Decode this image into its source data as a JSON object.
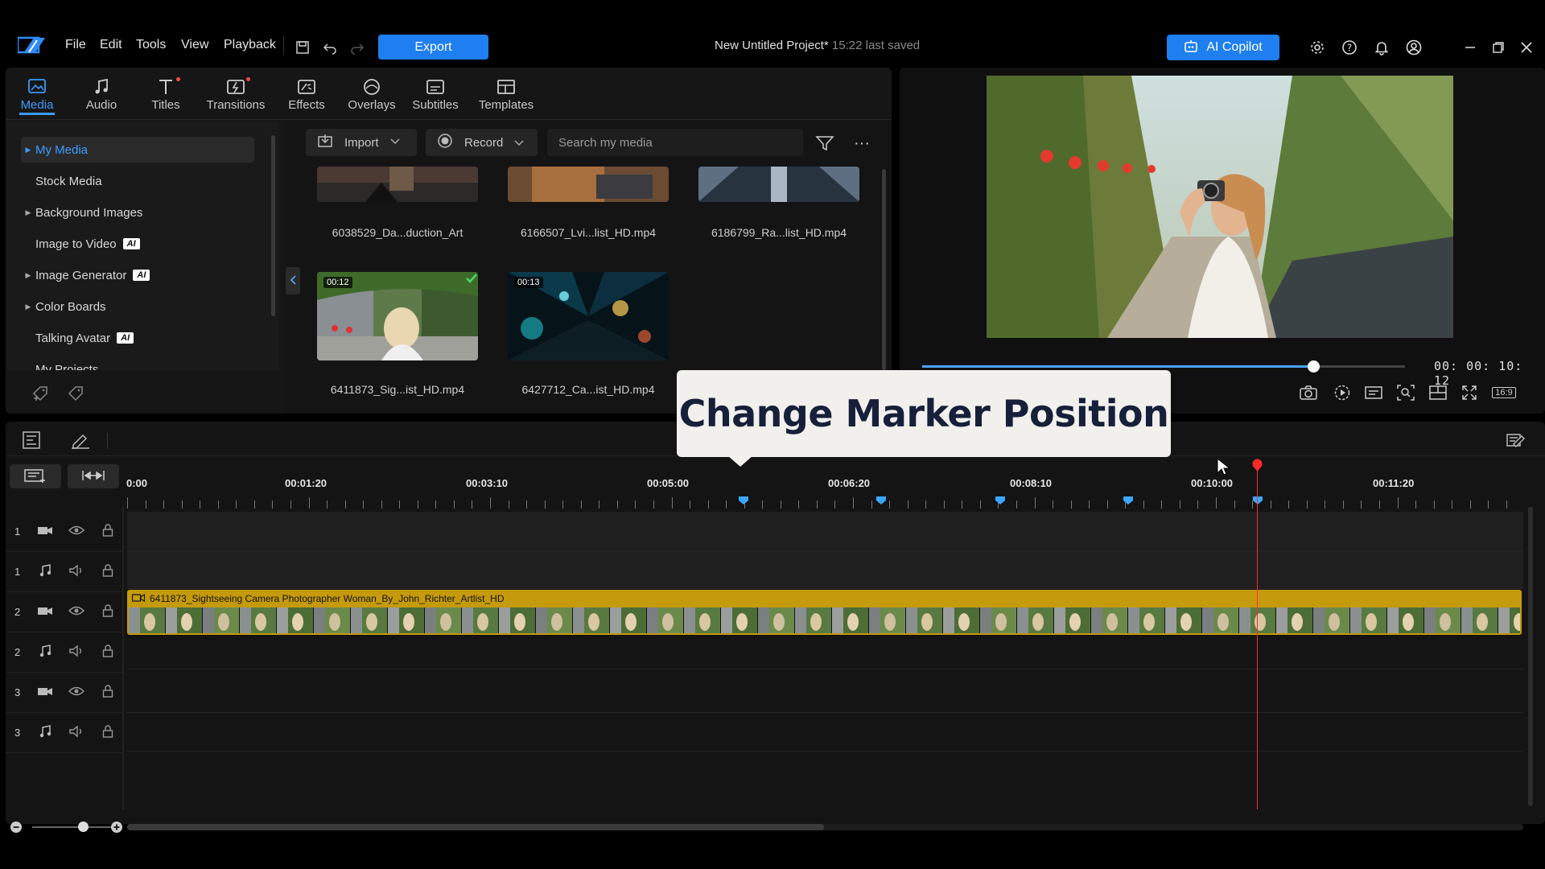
{
  "menu": {
    "file": "File",
    "edit": "Edit",
    "tools": "Tools",
    "view": "View",
    "playback": "Playback"
  },
  "toolbar": {
    "export_label": "Export"
  },
  "project": {
    "title": "New Untitled Project*",
    "saved": "15:22 last saved"
  },
  "ai_copilot": {
    "label": "AI Copilot"
  },
  "tabs": [
    {
      "label": "Media",
      "icon": "media-icon"
    },
    {
      "label": "Audio",
      "icon": "music-note-icon"
    },
    {
      "label": "Titles",
      "icon": "titles-icon"
    },
    {
      "label": "Transitions",
      "icon": "transitions-icon"
    },
    {
      "label": "Effects",
      "icon": "effects-icon"
    },
    {
      "label": "Overlays",
      "icon": "overlays-icon"
    },
    {
      "label": "Subtitles",
      "icon": "subtitles-icon"
    },
    {
      "label": "Templates",
      "icon": "templates-icon"
    }
  ],
  "tree": {
    "my_media": "My Media",
    "stock_media": "Stock Media",
    "background_images": "Background Images",
    "image_to_video": "Image to Video",
    "image_generator": "Image Generator",
    "color_boards": "Color Boards",
    "talking_avatar": "Talking Avatar",
    "my_projects": "My Projects",
    "ai_badge": "AI"
  },
  "media_toolbar": {
    "import_label": "Import",
    "record_label": "Record",
    "search_placeholder": "Search my media"
  },
  "media_items": [
    {
      "name": "6038529_Da...duction_Art"
    },
    {
      "name": "6166507_Lvi...list_HD.mp4"
    },
    {
      "name": "6186799_Ra...list_HD.mp4"
    },
    {
      "name": "6411873_Sig...ist_HD.mp4",
      "duration": "00:12"
    },
    {
      "name": "6427712_Ca...ist_HD.mp4",
      "duration": "00:13"
    }
  ],
  "preview": {
    "timecode": "00: 00: 10: 12",
    "progress": 0.81,
    "aspect": "16:9"
  },
  "callout": {
    "text": "Change Marker Position"
  },
  "ruler": {
    "labels": [
      "0:00",
      "00:01:20",
      "00:03:10",
      "00:05:00",
      "00:06:20",
      "00:08:10",
      "00:10:00",
      "00:11:20"
    ]
  },
  "tracks": [
    {
      "num": "1",
      "type": "video"
    },
    {
      "num": "1",
      "type": "audio"
    },
    {
      "num": "2",
      "type": "video"
    },
    {
      "num": "2",
      "type": "audio"
    },
    {
      "num": "3",
      "type": "video"
    },
    {
      "num": "3",
      "type": "audio"
    }
  ],
  "clip": {
    "title": "6411873_Sightseeing Camera Photographer Woman_By_John_Richter_Artlist_HD"
  },
  "colors": {
    "accent": "#1f7ff0",
    "clip": "#c59a0c",
    "playhead": "#ff2a2a",
    "marker": "#3aa8ff"
  }
}
